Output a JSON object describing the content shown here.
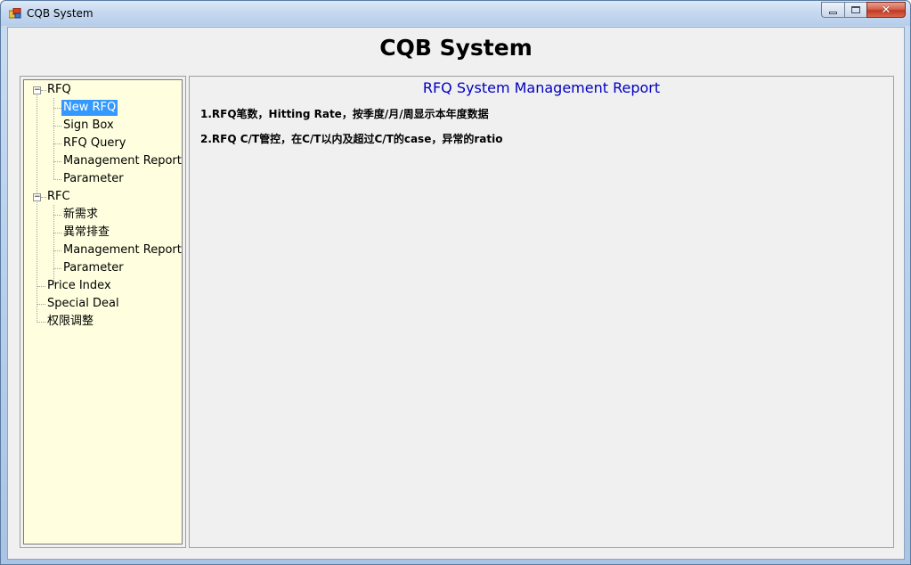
{
  "window": {
    "title": "CQB System",
    "controls": {
      "minimize": "minimize",
      "maximize": "maximize",
      "close": "close"
    }
  },
  "header": {
    "title": "CQB System"
  },
  "tree": {
    "nodes": [
      {
        "label": "RFQ",
        "expanded": true
      },
      {
        "label": "New RFQ",
        "selected": true
      },
      {
        "label": "Sign Box"
      },
      {
        "label": "RFQ Query"
      },
      {
        "label": "Management Report"
      },
      {
        "label": "Parameter"
      },
      {
        "label": "RFC",
        "expanded": true
      },
      {
        "label": "新需求"
      },
      {
        "label": "異常排查"
      },
      {
        "label": "Management Report"
      },
      {
        "label": "Parameter"
      },
      {
        "label": "Price Index"
      },
      {
        "label": "Special Deal"
      },
      {
        "label": "权限调整"
      }
    ],
    "background_color": "#ffffe0",
    "selection_color": "#3399ff"
  },
  "content": {
    "title": "RFQ System Management Report",
    "title_color": "#0000c0",
    "lines": [
      "1.RFQ笔数，Hitting Rate，按季度/月/周显示本年度数据",
      "2.RFQ C/T管控，在C/T以内及超过C/T的case，异常的ratio"
    ]
  }
}
